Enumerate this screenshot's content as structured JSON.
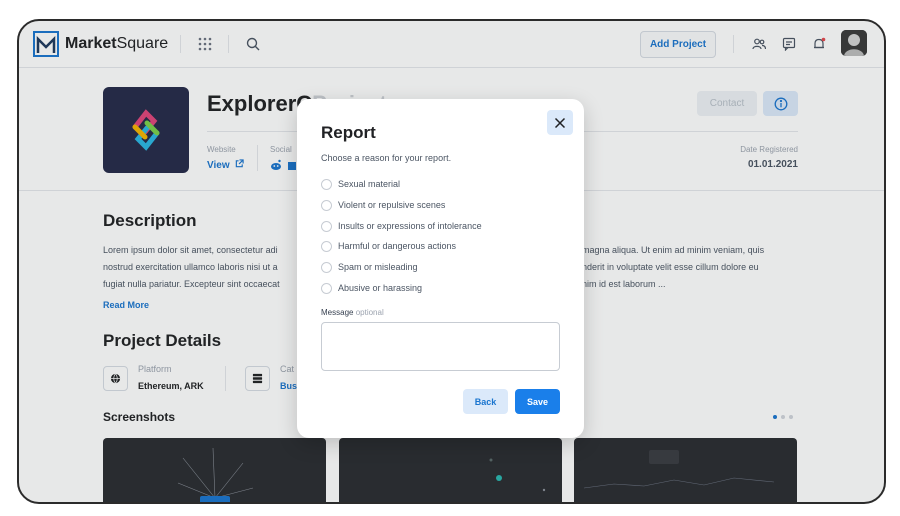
{
  "header": {
    "brand_bold": "Market",
    "brand_rest": "Square",
    "add_project_label": "Add Project",
    "icons": [
      "grid-icon",
      "search-icon",
      "users-icon",
      "chat-icon",
      "bell-icon"
    ]
  },
  "project": {
    "title_visible": "ExplorerC",
    "title_faded": "Project",
    "contact_label": "Contact",
    "website_label": "Website",
    "website_value": "View",
    "social_label": "Social",
    "date_registered_label": "Date Registered",
    "date_registered_value": "01.01.2021"
  },
  "description": {
    "title": "Description",
    "left_lines": [
      "Lorem ipsum dolor sit amet, consectetur adi",
      "nostrud exercitation ullamco laboris nisi ut a",
      "fugiat nulla pariatur. Excepteur sint occaecat"
    ],
    "right_lines": [
      "magna aliqua. Ut enim ad minim veniam, quis",
      "nderit in voluptate velit esse cillum dolore eu",
      "nim id est laborum ..."
    ],
    "read_more": "Read More"
  },
  "details": {
    "title": "Project Details",
    "platform_label": "Platform",
    "platform_value": "Ethereum, ARK",
    "category_label": "Cat",
    "category_value": "Bus"
  },
  "screenshots": {
    "title": "Screenshots"
  },
  "modal": {
    "title": "Report",
    "subtitle": "Choose a reason for your report.",
    "reasons": [
      "Sexual material",
      "Violent or repulsive scenes",
      "Insults or expressions of intolerance",
      "Harmful or dangerous actions",
      "Spam or misleading",
      "Abusive or harassing"
    ],
    "message_label": "Message",
    "message_optional": "optional",
    "message_value": "",
    "back_label": "Back",
    "save_label": "Save"
  },
  "colors": {
    "accent": "#1a7fea",
    "accent_light": "#dbe9fa",
    "text": "#212225"
  }
}
